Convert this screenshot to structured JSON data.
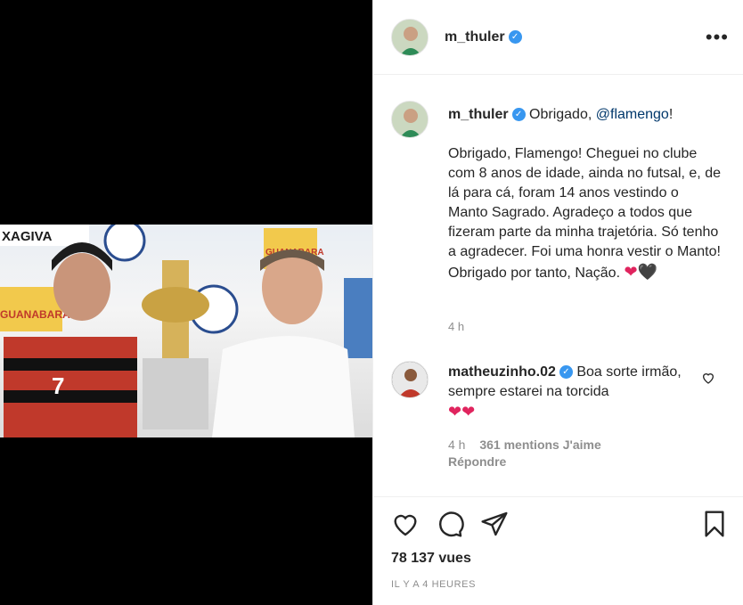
{
  "post": {
    "author": "m_thuler",
    "caption_intro": "Obrigado,",
    "caption_mention": "@flamengo",
    "caption_intro_end": "!",
    "caption_body": "Obrigado, Flamengo! Cheguei no clube com 8 anos de idade, ainda no futsal, e, de lá para cá, foram 14 anos vestindo o Manto Sagrado. Agradeço a todos que fizeram parte da minha trajetória. Só tenho a agradecer. Foi uma honra vestir o Manto! Obrigado por tanto, Nação.",
    "caption_time": "4 h",
    "views": "78 137 vues",
    "posted_ago": "IL Y A 4 HEURES"
  },
  "photo": {
    "banner_left": "XAGIVA",
    "banner_left2": "GUANABARA",
    "banner_right": "GUANABARA",
    "jersey_number": "7"
  },
  "comment": {
    "author": "matheuzinho.02",
    "text": "Boa sorte irmão, sempre estarei na torcida",
    "time": "4 h",
    "likes": "361 mentions J'aime",
    "reply": "Répondre"
  },
  "icons": {
    "more": "more-options-icon",
    "verified": "verified-badge-icon",
    "like": "heart-outline-icon",
    "comment": "comment-bubble-icon",
    "share": "paper-plane-icon",
    "save": "bookmark-icon"
  },
  "colors": {
    "verified": "#3897f0",
    "heart_red": "#e0245e",
    "mention": "#00376b",
    "muted": "#8e8e8e"
  }
}
